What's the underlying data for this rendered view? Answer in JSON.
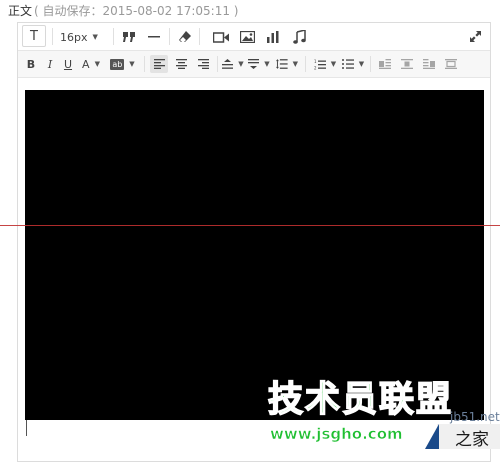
{
  "header": {
    "label": "正文",
    "autosave": "( 自动保存：2015-08-02 17:05:11 )"
  },
  "toolbar": {
    "text_button": "T",
    "font_size": "16px"
  },
  "watermark": {
    "brand": "技术员联盟",
    "url": "www.jsgho.com",
    "site_small": "jb51.net",
    "corner": "之家"
  },
  "colors": {
    "accent_green": "#1fbf31",
    "corner_blue": "#1a4a8a",
    "guide_red": "#c03030",
    "content_bg": "#000000"
  }
}
